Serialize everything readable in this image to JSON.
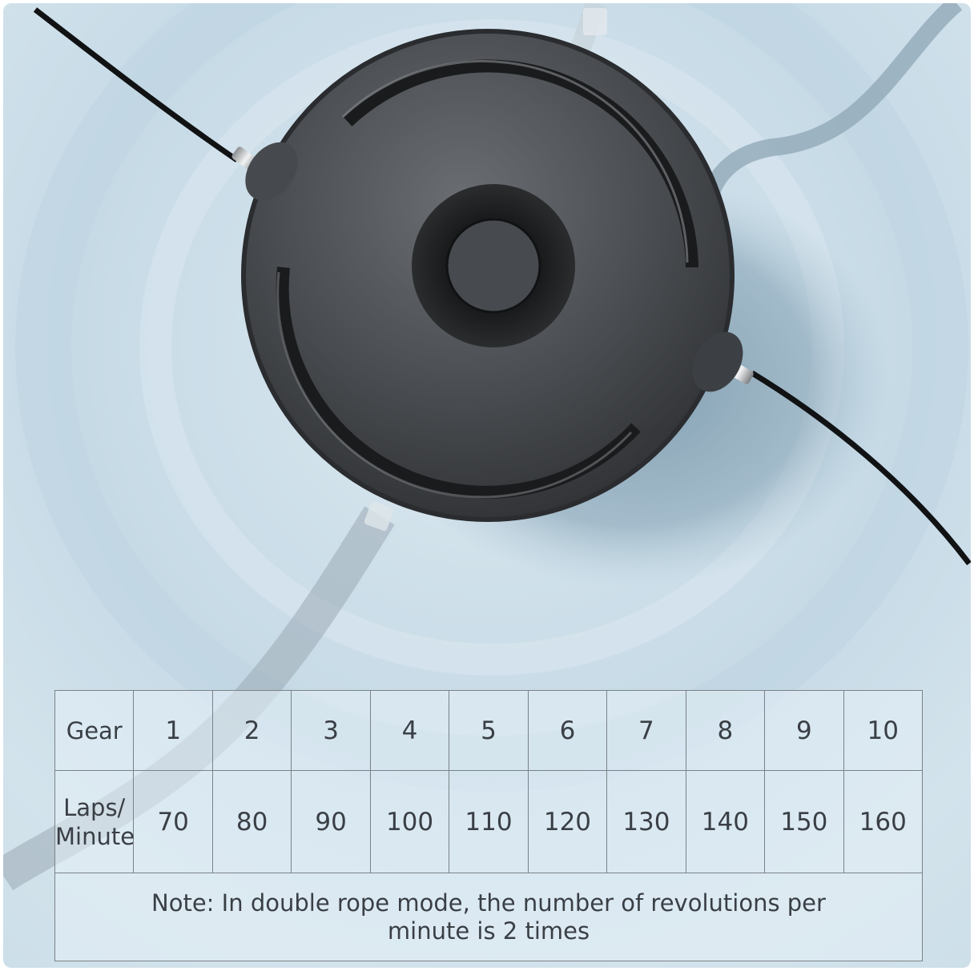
{
  "table": {
    "row_gear": {
      "label": "Gear",
      "values": [
        "1",
        "2",
        "3",
        "4",
        "5",
        "6",
        "7",
        "8",
        "9",
        "10"
      ]
    },
    "row_laps": {
      "label_line1": "Laps/",
      "label_line2": "Minute",
      "values": [
        "70",
        "80",
        "90",
        "100",
        "110",
        "120",
        "130",
        "140",
        "150",
        "160"
      ]
    },
    "note": "Note: In double rope mode, the number of revolutions per minute is 2 times"
  },
  "colors": {
    "background": "#cfe0ea",
    "device_body": "#3f4245",
    "table_border": "#7a8288",
    "table_text": "#3a3f45"
  }
}
